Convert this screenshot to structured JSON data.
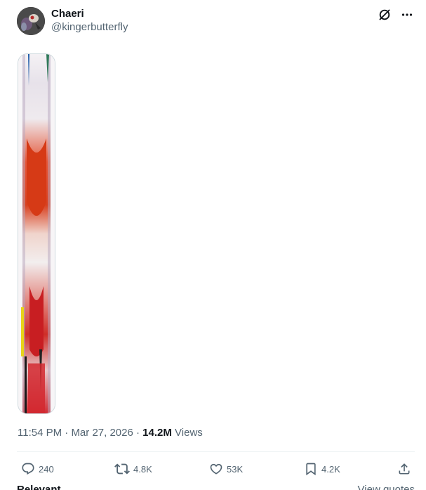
{
  "author": {
    "name": "Chaeri",
    "handle": "@kingerbutterfly"
  },
  "header": {
    "grok_icon": "grok-slash-icon",
    "more_icon": "more-horizontal-icon"
  },
  "post": {
    "time": "11:54 PM",
    "separator": "·",
    "date": "Mar 27, 2026",
    "views_count": "14.2M",
    "views_label": "Views"
  },
  "actions": {
    "replies": "240",
    "reposts": "4.8K",
    "likes": "53K",
    "bookmarks": "4.2K"
  },
  "footer": {
    "left": "Relevant",
    "right": "View quotes"
  },
  "colors": {
    "text_primary": "#0f1419",
    "text_secondary": "#536471",
    "border": "#cfd9de"
  }
}
